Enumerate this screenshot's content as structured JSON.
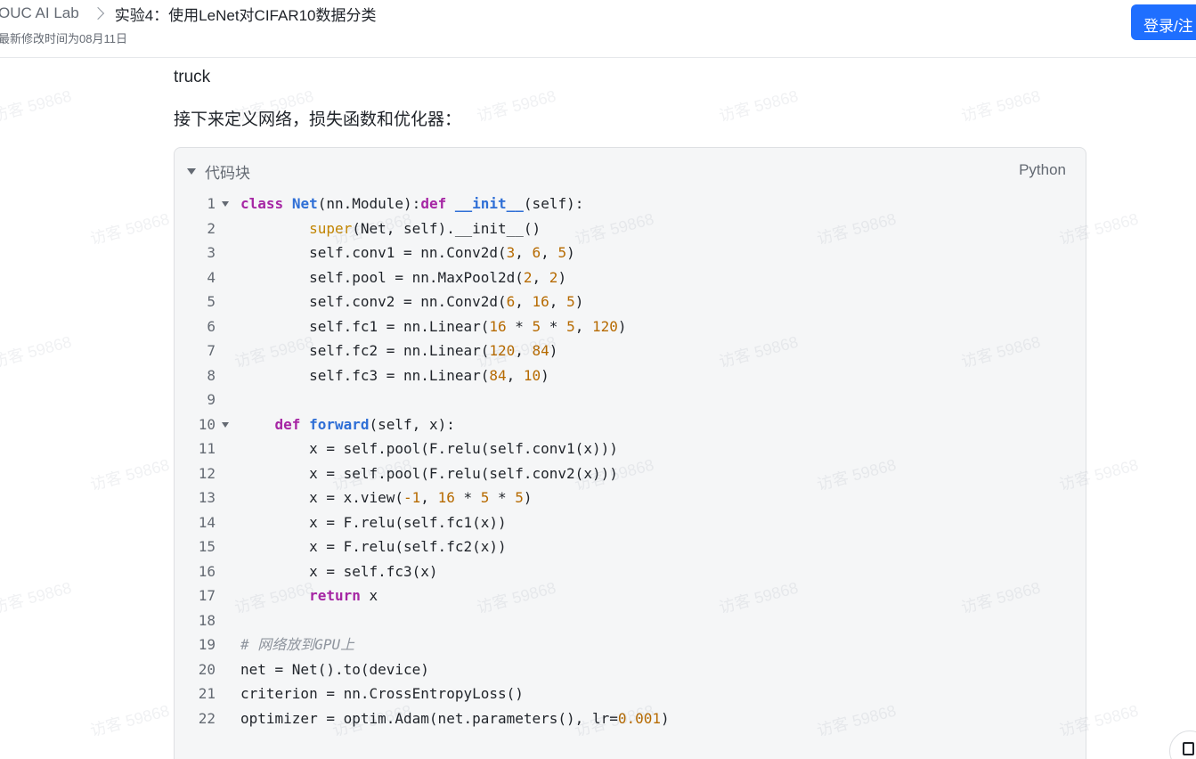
{
  "header": {
    "breadcrumb_root": "OUC AI Lab",
    "doc_title": "实验4：使用LeNet对CIFAR10数据分类",
    "last_modified": "最新修改时间为08月11日",
    "login_label": "登录/注"
  },
  "watermark": "访客 59868",
  "content": {
    "paragraph_truck": "truck",
    "paragraph_intro": "接下来定义网络，损失函数和优化器："
  },
  "code_block": {
    "title": "代码块",
    "language": "Python",
    "lines": [
      {
        "no": "1",
        "fold": true,
        "tokens": [
          [
            "k",
            "class"
          ],
          [
            "t",
            " "
          ],
          [
            "fn",
            "Net"
          ],
          [
            "t",
            "(nn.Module):"
          ],
          [
            "k",
            "def"
          ],
          [
            "t",
            " "
          ],
          [
            "fn",
            "__init__"
          ],
          [
            "t",
            "(self):"
          ]
        ]
      },
      {
        "no": "2",
        "tokens": [
          [
            "t",
            "        "
          ],
          [
            "bi",
            "super"
          ],
          [
            "t",
            "(Net, self).__init__()"
          ]
        ]
      },
      {
        "no": "3",
        "tokens": [
          [
            "t",
            "        self.conv1 = nn.Conv2d("
          ],
          [
            "nm",
            "3"
          ],
          [
            "t",
            ", "
          ],
          [
            "nm",
            "6"
          ],
          [
            "t",
            ", "
          ],
          [
            "nm",
            "5"
          ],
          [
            "t",
            ")"
          ]
        ]
      },
      {
        "no": "4",
        "tokens": [
          [
            "t",
            "        self.pool = nn.MaxPool2d("
          ],
          [
            "nm",
            "2"
          ],
          [
            "t",
            ", "
          ],
          [
            "nm",
            "2"
          ],
          [
            "t",
            ")"
          ]
        ]
      },
      {
        "no": "5",
        "tokens": [
          [
            "t",
            "        self.conv2 = nn.Conv2d("
          ],
          [
            "nm",
            "6"
          ],
          [
            "t",
            ", "
          ],
          [
            "nm",
            "16"
          ],
          [
            "t",
            ", "
          ],
          [
            "nm",
            "5"
          ],
          [
            "t",
            ")"
          ]
        ]
      },
      {
        "no": "6",
        "tokens": [
          [
            "t",
            "        self.fc1 = nn.Linear("
          ],
          [
            "nm",
            "16"
          ],
          [
            "t",
            " * "
          ],
          [
            "nm",
            "5"
          ],
          [
            "t",
            " * "
          ],
          [
            "nm",
            "5"
          ],
          [
            "t",
            ", "
          ],
          [
            "nm",
            "120"
          ],
          [
            "t",
            ")"
          ]
        ]
      },
      {
        "no": "7",
        "tokens": [
          [
            "t",
            "        self.fc2 = nn.Linear("
          ],
          [
            "nm",
            "120"
          ],
          [
            "t",
            ", "
          ],
          [
            "nm",
            "84"
          ],
          [
            "t",
            ")"
          ]
        ]
      },
      {
        "no": "8",
        "tokens": [
          [
            "t",
            "        self.fc3 = nn.Linear("
          ],
          [
            "nm",
            "84"
          ],
          [
            "t",
            ", "
          ],
          [
            "nm",
            "10"
          ],
          [
            "t",
            ")"
          ]
        ]
      },
      {
        "no": "9",
        "tokens": []
      },
      {
        "no": "10",
        "fold": true,
        "tokens": [
          [
            "t",
            "    "
          ],
          [
            "k",
            "def"
          ],
          [
            "t",
            " "
          ],
          [
            "fn",
            "forward"
          ],
          [
            "t",
            "(self, x):"
          ]
        ]
      },
      {
        "no": "11",
        "tokens": [
          [
            "t",
            "        x = self.pool(F.relu(self.conv1(x)))"
          ]
        ]
      },
      {
        "no": "12",
        "tokens": [
          [
            "t",
            "        x = self.pool(F.relu(self.conv2(x)))"
          ]
        ]
      },
      {
        "no": "13",
        "tokens": [
          [
            "t",
            "        x = x.view("
          ],
          [
            "nm",
            "-1"
          ],
          [
            "t",
            ", "
          ],
          [
            "nm",
            "16"
          ],
          [
            "t",
            " * "
          ],
          [
            "nm",
            "5"
          ],
          [
            "t",
            " * "
          ],
          [
            "nm",
            "5"
          ],
          [
            "t",
            ")"
          ]
        ]
      },
      {
        "no": "14",
        "tokens": [
          [
            "t",
            "        x = F.relu(self.fc1(x))"
          ]
        ]
      },
      {
        "no": "15",
        "tokens": [
          [
            "t",
            "        x = F.relu(self.fc2(x))"
          ]
        ]
      },
      {
        "no": "16",
        "tokens": [
          [
            "t",
            "        x = self.fc3(x)"
          ]
        ]
      },
      {
        "no": "17",
        "tokens": [
          [
            "t",
            "        "
          ],
          [
            "k",
            "return"
          ],
          [
            "t",
            " x"
          ]
        ]
      },
      {
        "no": "18",
        "tokens": []
      },
      {
        "no": "19",
        "tokens": [
          [
            "cm",
            "# 网络放到GPU上"
          ]
        ]
      },
      {
        "no": "20",
        "tokens": [
          [
            "t",
            "net = Net().to(device)"
          ]
        ]
      },
      {
        "no": "21",
        "tokens": [
          [
            "t",
            "criterion = nn.CrossEntropyLoss()"
          ]
        ]
      },
      {
        "no": "22",
        "tokens": [
          [
            "t",
            "optimizer = optim.Adam(net.parameters(), lr="
          ],
          [
            "nm",
            "0.001"
          ],
          [
            "t",
            ")"
          ]
        ]
      }
    ]
  }
}
